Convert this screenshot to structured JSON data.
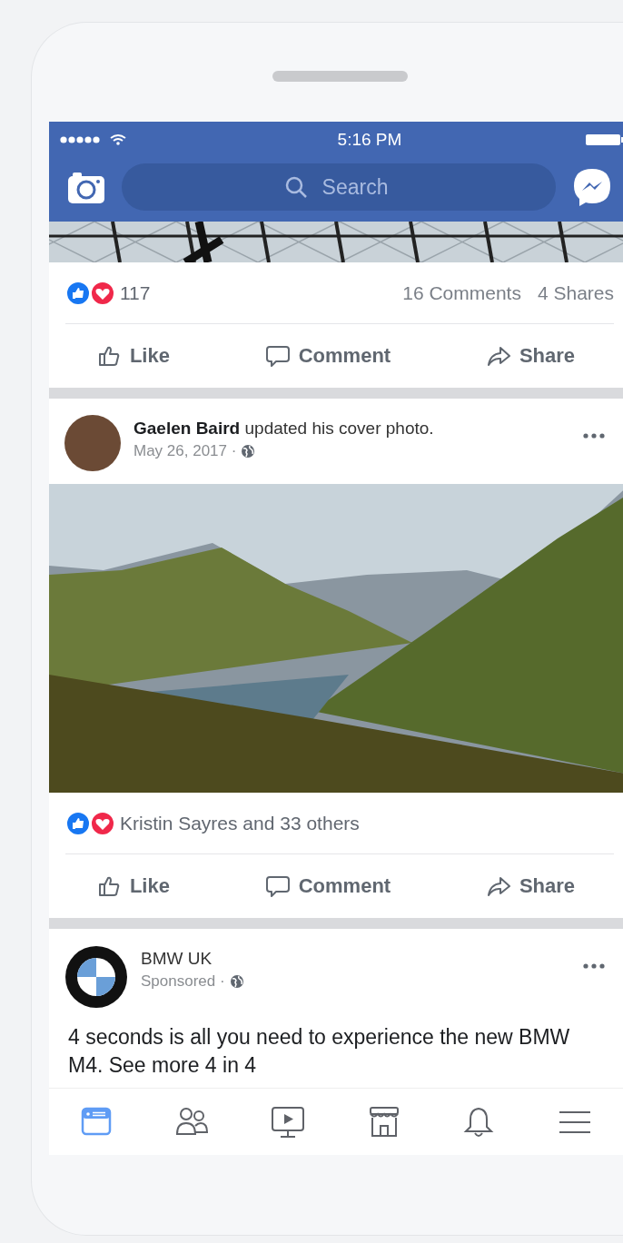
{
  "status_bar": {
    "time": "5:16 PM"
  },
  "nav": {
    "search": {
      "placeholder": "Search"
    }
  },
  "posts": [
    {
      "photo": {
        "kind": "lattice"
      },
      "reactions": {
        "summary": "117",
        "comments": "16 Comments",
        "shares": "4 Shares"
      },
      "actions": [
        {
          "kind": "like",
          "label": "Like"
        },
        {
          "kind": "comment",
          "label": "Comment"
        },
        {
          "kind": "share",
          "label": "Share"
        }
      ]
    },
    {
      "header": {
        "kind": "person",
        "title": "**Gaelen Baird** updated his cover photo.",
        "subtitle": "May 26, 2017 ·"
      },
      "photo": {
        "kind": "landscape"
      },
      "reactions": {
        "summary": "Kristin Sayres and 33 others"
      },
      "actions": [
        {
          "kind": "like",
          "label": "Like"
        },
        {
          "kind": "comment",
          "label": "Comment"
        },
        {
          "kind": "share",
          "label": "Share"
        }
      ]
    },
    {
      "header": {
        "kind": "page",
        "title": "BMW UK",
        "subtitle": "Sponsored ·"
      },
      "text": "4 seconds is all you need to experience the new BMW M4. See more 4 in 4"
    }
  ],
  "tab_bar": [
    {
      "kind": "feed",
      "selected": true
    },
    {
      "kind": "friends",
      "selected": false
    },
    {
      "kind": "watch",
      "selected": false
    },
    {
      "kind": "marketplace",
      "selected": false
    },
    {
      "kind": "notifications",
      "selected": false
    },
    {
      "kind": "menu",
      "selected": false
    }
  ]
}
